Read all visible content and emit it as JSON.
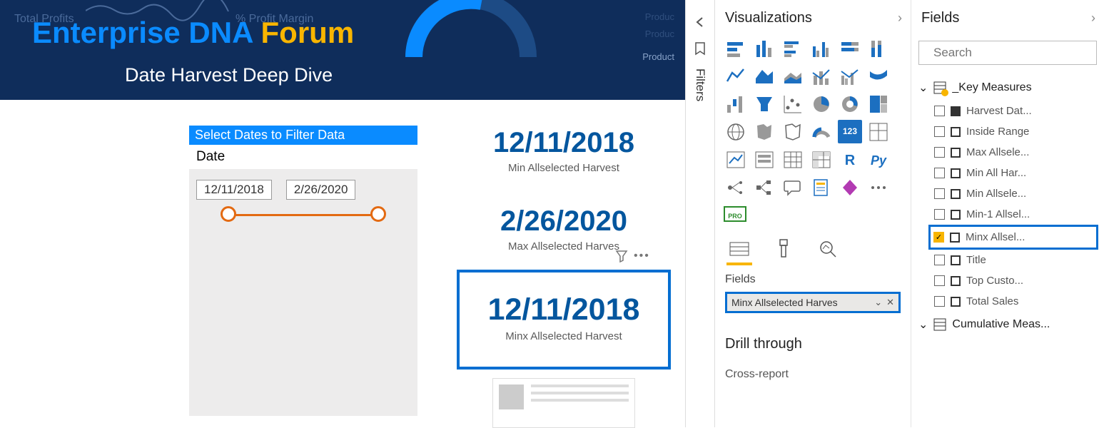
{
  "header": {
    "bg_labels": {
      "profits": "Total Profits",
      "margin": "% Profit Margin",
      "p1": "Produc",
      "p2": "Produc",
      "p3": "Product"
    },
    "brand_a": "Enterprise DNA ",
    "brand_b": "Forum",
    "subtitle": "Date Harvest Deep Dive"
  },
  "slicer": {
    "title": "Select Dates to Filter Data",
    "field": "Date",
    "from": "12/11/2018",
    "to": "2/26/2020"
  },
  "cards": {
    "c1_val": "12/11/2018",
    "c1_lbl": "Min Allselected Harvest",
    "c2_val": "2/26/2020",
    "c2_lbl": "Max Allselected Harves",
    "c3_val": "12/11/2018",
    "c3_lbl": "Minx Allselected Harvest"
  },
  "panes": {
    "filters": "Filters",
    "viz_title": "Visualizations",
    "fields_title": "Fields",
    "search_placeholder": "Search",
    "section_fields": "Fields",
    "well": "Minx Allselected Harves",
    "drill": "Drill through",
    "cross": "Cross-report"
  },
  "field_groups": {
    "g1": "_Key Measures",
    "items": [
      "Harvest Dat...",
      "Inside Range",
      "Max Allsele...",
      "Min All Har...",
      "Min Allsele...",
      "Min-1 Allsel...",
      "Minx Allsel...",
      "Title",
      "Top Custo...",
      "Total Sales"
    ],
    "checked_idx": 6,
    "g2": "Cumulative Meas..."
  }
}
